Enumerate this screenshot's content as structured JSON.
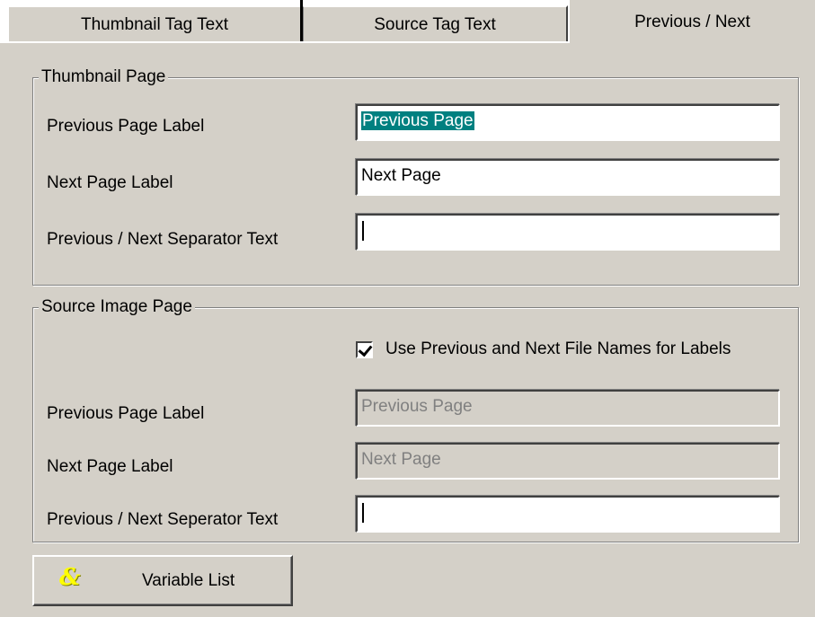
{
  "tabs": [
    {
      "label": "Thumbnail Tag Text"
    },
    {
      "label": "Source Tag Text"
    },
    {
      "label": "Previous / Next"
    }
  ],
  "thumbnail_page": {
    "legend": "Thumbnail Page",
    "prev_label": "Previous Page Label",
    "prev_value": "Previous Page",
    "next_label": "Next Page Label",
    "next_value": "Next Page",
    "sep_label": "Previous / Next Separator Text",
    "sep_value": ""
  },
  "source_page": {
    "legend": "Source Image Page",
    "checkbox_label": "Use Previous and Next File Names for Labels",
    "checkbox_checked": true,
    "prev_label": "Previous Page Label",
    "prev_value": "Previous Page",
    "next_label": "Next Page Label",
    "next_value": "Next Page",
    "sep_label": "Previous / Next Seperator Text",
    "sep_value": ""
  },
  "variable_button": {
    "icon": "&",
    "label": "Variable List"
  }
}
